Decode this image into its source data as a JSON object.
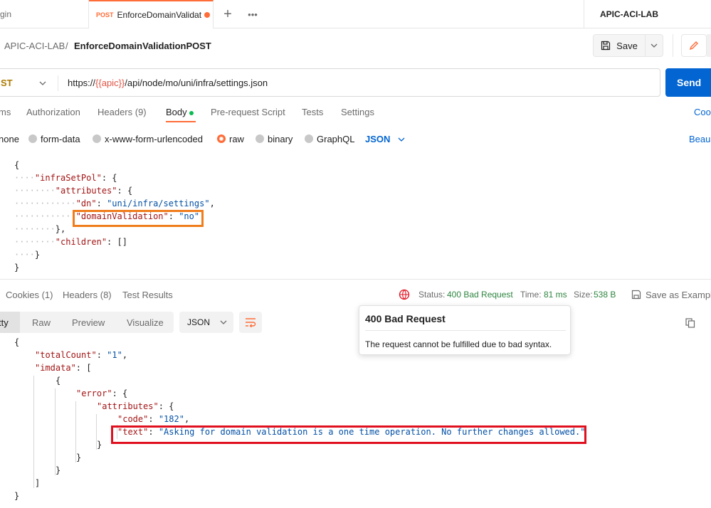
{
  "tabs": {
    "left_partial": "gin",
    "active_method": "POST",
    "active_title": "EnforceDomainValidat",
    "workspace": "APIC-ACI-LAB"
  },
  "breadcrumb": {
    "collection": "APIC-ACI-LAB",
    "separator": "/",
    "request": "EnforceDomainValidationPOST"
  },
  "toolbar": {
    "save_label": "Save"
  },
  "url": {
    "method": "ST",
    "prefix": "https://",
    "var": "{{apic}}",
    "path": "/api/node/mo/uni/infra/settings.json",
    "send_label": "Send"
  },
  "request_tabs": [
    "ms",
    "Authorization",
    "Headers (9)",
    "Body",
    "Pre-request Script",
    "Tests",
    "Settings"
  ],
  "request_tabs_right": "Coo",
  "body_types": [
    "none",
    "form-data",
    "x-www-form-urlencoded",
    "raw",
    "binary",
    "GraphQL"
  ],
  "body_format": "JSON",
  "beautify": "Beau",
  "request_body": {
    "infraSetPol_key": "\"infraSetPol\"",
    "attributes_key": "\"attributes\"",
    "dn_key": "\"dn\"",
    "dn_val": "\"uni/infra/settings\"",
    "dv_key": "\"domainValidation\"",
    "dv_val": "\"no\"",
    "children_key": "\"children\"",
    "children_val": "[]"
  },
  "response_tabs": [
    "Cookies (1)",
    "Headers (8)",
    "Test Results"
  ],
  "status": {
    "label": "Status:",
    "value": "400 Bad Request",
    "time_label": "Time:",
    "time_value": "81 ms",
    "size_label": "Size:",
    "size_value": "538 B",
    "save_example": "Save as Example"
  },
  "response_views": [
    "tty",
    "Raw",
    "Preview",
    "Visualize"
  ],
  "response_format": "JSON",
  "tooltip": {
    "title": "400 Bad Request",
    "body": "The request cannot be fulfilled due to bad syntax."
  },
  "response_body": {
    "totalCount_key": "\"totalCount\"",
    "totalCount_val": "\"1\"",
    "imdata_key": "\"imdata\"",
    "error_key": "\"error\"",
    "attributes_key": "\"attributes\"",
    "code_key": "\"code\"",
    "code_val": "\"182\"",
    "text_key": "\"text\"",
    "text_val": "\"Asking for domain validation is a one time operation. No further changes allowed.\""
  },
  "colors": {
    "accent": "#ff6c37",
    "send": "#0265d2",
    "status_ok_text": "#2e8540",
    "highlight_orange": "#f07d1b",
    "highlight_red": "#e0101f"
  }
}
